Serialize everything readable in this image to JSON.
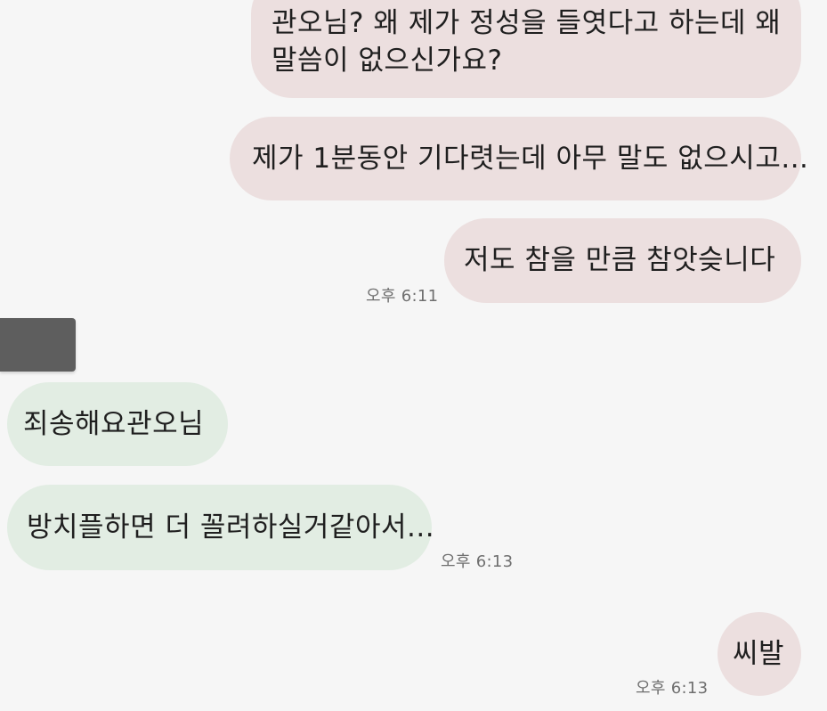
{
  "messages": [
    {
      "id": "m1",
      "direction": "outgoing",
      "lines": [
        "관오님? 왜 제가 정성을 들엿다고 하는데 왜",
        "말씀이 없으신가요?"
      ]
    },
    {
      "id": "m2",
      "direction": "outgoing",
      "text": "제가 1분동안 기다렷는데 아무 말도 없으시고..."
    },
    {
      "id": "m3",
      "direction": "outgoing",
      "text": "저도 참을 만큼 참앗슺니다",
      "time": "오후 6:11"
    },
    {
      "id": "m4",
      "direction": "incoming",
      "text": "죄송해요관오님"
    },
    {
      "id": "m5",
      "direction": "incoming",
      "text": "방치플하면 더 꼴려하실거같아서...",
      "time": "오후 6:13"
    },
    {
      "id": "m6",
      "direction": "outgoing",
      "text": "씨발",
      "time": "오후 6:13"
    }
  ],
  "colors": {
    "background": "#f6f6f6",
    "outgoing_bubble": "#ecdfdf",
    "incoming_bubble": "#e2ede3",
    "timestamp": "#6f6f6f",
    "avatar": "#5e5e5e"
  }
}
